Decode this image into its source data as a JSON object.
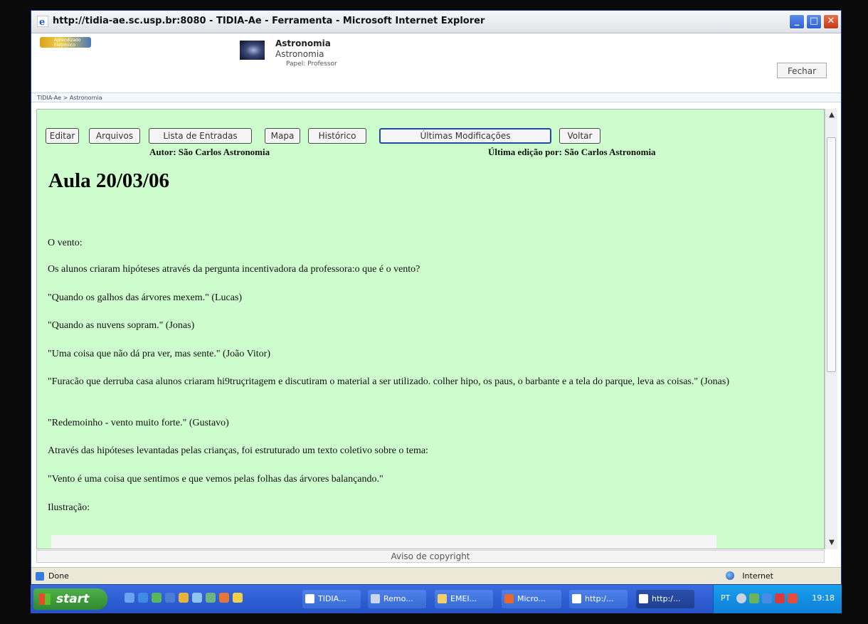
{
  "window": {
    "title": "http://tidia-ae.sc.usp.br:8080 - TIDIA-Ae - Ferramenta - Microsoft Internet Explorer",
    "minimize": "_",
    "maximize": "□",
    "close": "✕"
  },
  "header": {
    "logo_text": "Aprendizado Eletrônico",
    "course_title": "Astronomia",
    "course_subtitle": "Astronomia",
    "role": "Papel: Professor",
    "close_label": "Fechar",
    "breadcrumb": "TIDIA-Ae > Astronomia"
  },
  "toolbar": {
    "buttons": [
      {
        "label": "Editar"
      },
      {
        "label": "Arquivos"
      },
      {
        "label": "Lista de Entradas"
      },
      {
        "label": "Mapa"
      },
      {
        "label": "Histórico"
      },
      {
        "label": "Últimas Modificações"
      },
      {
        "label": "Voltar"
      }
    ]
  },
  "page": {
    "author": "Autor: São Carlos Astronomia",
    "last_edit": "Última edição por: São Carlos Astronomia",
    "title": "Aula 20/03/06",
    "paragraphs": [
      "O vento:",
      "Os alunos criaram hipóteses através da pergunta incentivadora da professora:o que é o vento?",
      "\"Quando os galhos das árvores mexem.\" (Lucas)",
      "\"Quando as nuvens sopram.\" (Jonas)",
      "\"Uma coisa que não dá pra ver, mas sente.\" (João Vitor)",
      "\"Furacão que derruba casa alunos criaram hi9truçritagem e discutiram o material a ser utilizado. colher hipo, os paus, o barbante e a tela do parque, leva as coisas.\" (Jonas)",
      "\"Redemoinho - vento muito forte.\" (Gustavo)",
      "Através das hipóteses levantadas pelas crianças, foi estruturado um texto coletivo sobre o tema:",
      "\"Vento é uma coisa que sentimos e que vemos pelas folhas das árvores balançando.\"",
      "Ilustração:"
    ],
    "copyright": "Aviso de copyright"
  },
  "status": {
    "text": "Done",
    "zone": "Internet"
  },
  "taskbar": {
    "start": "start",
    "tasks": [
      {
        "label": "TIDIA..."
      },
      {
        "label": "Remo..."
      },
      {
        "label": "EMEI..."
      },
      {
        "label": "Micro..."
      },
      {
        "label": "http:/..."
      },
      {
        "label": "http:/..."
      }
    ],
    "lang": "PT",
    "clock": "19:18"
  },
  "colors": {
    "content_bg": "#cdfccd",
    "taskbar": "#2553c7",
    "start": "#3c9a36"
  }
}
